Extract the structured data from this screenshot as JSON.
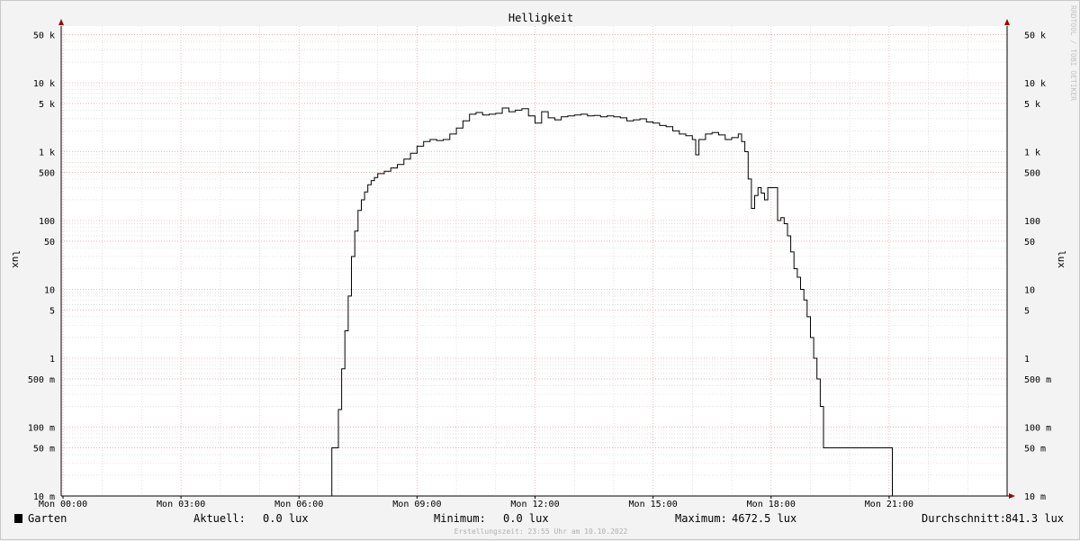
{
  "chart_data": {
    "type": "line",
    "title": "Helligkeit",
    "ylabel": "lux",
    "yscale": "log",
    "ylim": [
      0.01,
      50000
    ],
    "xlim_hours": [
      0,
      24
    ],
    "x_ticks": [
      {
        "h": 0,
        "label": "Mon 00:00"
      },
      {
        "h": 3,
        "label": "Mon 03:00"
      },
      {
        "h": 6,
        "label": "Mon 06:00"
      },
      {
        "h": 9,
        "label": "Mon 09:00"
      },
      {
        "h": 12,
        "label": "Mon 12:00"
      },
      {
        "h": 15,
        "label": "Mon 15:00"
      },
      {
        "h": 18,
        "label": "Mon 18:00"
      },
      {
        "h": 21,
        "label": "Mon 21:00"
      }
    ],
    "y_ticks": [
      {
        "v": 0.01,
        "label": "10 m"
      },
      {
        "v": 0.05,
        "label": "50 m"
      },
      {
        "v": 0.1,
        "label": "100 m"
      },
      {
        "v": 0.5,
        "label": "500 m"
      },
      {
        "v": 1,
        "label": "1"
      },
      {
        "v": 5,
        "label": "5"
      },
      {
        "v": 10,
        "label": "10"
      },
      {
        "v": 50,
        "label": "50"
      },
      {
        "v": 100,
        "label": "100"
      },
      {
        "v": 500,
        "label": "500"
      },
      {
        "v": 1000,
        "label": "1 k"
      },
      {
        "v": 5000,
        "label": "5 k"
      },
      {
        "v": 10000,
        "label": "10 k"
      },
      {
        "v": 50000,
        "label": "50 k"
      }
    ],
    "grid": true,
    "colors": {
      "line": "#000000",
      "major_grid": "#e8a0a0",
      "minor_grid": "#cfcfcf",
      "axis": "#000000",
      "arrow": "#a00000"
    },
    "series": [
      {
        "name": "Garten",
        "x": [
          "00:00",
          "06:50",
          "07:00",
          "07:05",
          "07:10",
          "07:15",
          "07:20",
          "07:25",
          "07:30",
          "07:35",
          "07:40",
          "07:45",
          "07:50",
          "07:55",
          "08:00",
          "08:10",
          "08:20",
          "08:30",
          "08:40",
          "08:50",
          "09:00",
          "09:10",
          "09:20",
          "09:30",
          "09:40",
          "09:50",
          "10:00",
          "10:10",
          "10:20",
          "10:30",
          "10:40",
          "10:50",
          "11:00",
          "11:10",
          "11:20",
          "11:30",
          "11:40",
          "11:50",
          "12:00",
          "12:10",
          "12:20",
          "12:30",
          "12:40",
          "12:50",
          "13:00",
          "13:10",
          "13:20",
          "13:30",
          "13:40",
          "13:50",
          "14:00",
          "14:10",
          "14:20",
          "14:30",
          "14:40",
          "14:50",
          "15:00",
          "15:10",
          "15:20",
          "15:30",
          "15:40",
          "15:50",
          "16:00",
          "16:05",
          "16:10",
          "16:20",
          "16:30",
          "16:40",
          "16:50",
          "17:00",
          "17:10",
          "17:15",
          "17:20",
          "17:25",
          "17:30",
          "17:35",
          "17:40",
          "17:45",
          "17:50",
          "17:55",
          "18:00",
          "18:10",
          "18:15",
          "18:20",
          "18:25",
          "18:30",
          "18:35",
          "18:40",
          "18:45",
          "18:50",
          "18:55",
          "19:00",
          "19:05",
          "19:10",
          "19:15",
          "19:20",
          "19:25",
          "19:30",
          "19:35",
          "19:40",
          "19:50",
          "20:00",
          "20:30",
          "21:00",
          "21:05",
          "24:00"
        ],
        "y": [
          0.01,
          0.05,
          0.18,
          0.7,
          2.5,
          8,
          30,
          70,
          140,
          200,
          260,
          330,
          380,
          420,
          480,
          520,
          580,
          650,
          780,
          950,
          1200,
          1400,
          1500,
          1450,
          1500,
          1800,
          2200,
          2800,
          3500,
          3700,
          3400,
          3500,
          3600,
          4300,
          3800,
          4000,
          4200,
          3300,
          2600,
          3800,
          3100,
          2900,
          3200,
          3300,
          3400,
          3500,
          3300,
          3350,
          3200,
          3300,
          3200,
          3100,
          2800,
          2900,
          3000,
          2700,
          2600,
          2400,
          2300,
          2000,
          1800,
          1700,
          1500,
          900,
          1500,
          1800,
          1900,
          1750,
          1500,
          1600,
          1800,
          1400,
          1000,
          400,
          150,
          230,
          300,
          250,
          200,
          300,
          300,
          100,
          110,
          90,
          60,
          35,
          20,
          15,
          10,
          7,
          4,
          2,
          1,
          0.5,
          0.2,
          0.05,
          0.05,
          0.05,
          0.05,
          0.05,
          0.05,
          0.05,
          0.05,
          0.05,
          0.01,
          0.01
        ]
      }
    ]
  },
  "legend": {
    "series_name": "Garten",
    "current_label": "Aktuell:",
    "current_value": "0.0 lux",
    "min_label": "Minimum:",
    "min_value": "0.0 lux",
    "max_label": "Maximum:",
    "max_value": "4672.5 lux",
    "avg_label": "Durchschnitt:",
    "avg_value": "841.3 lux"
  },
  "footer": "Erstellungszeit: 23:55 Uhr am 10.10.2022",
  "watermark": "RRDTOOL / TOBI OETIKER"
}
